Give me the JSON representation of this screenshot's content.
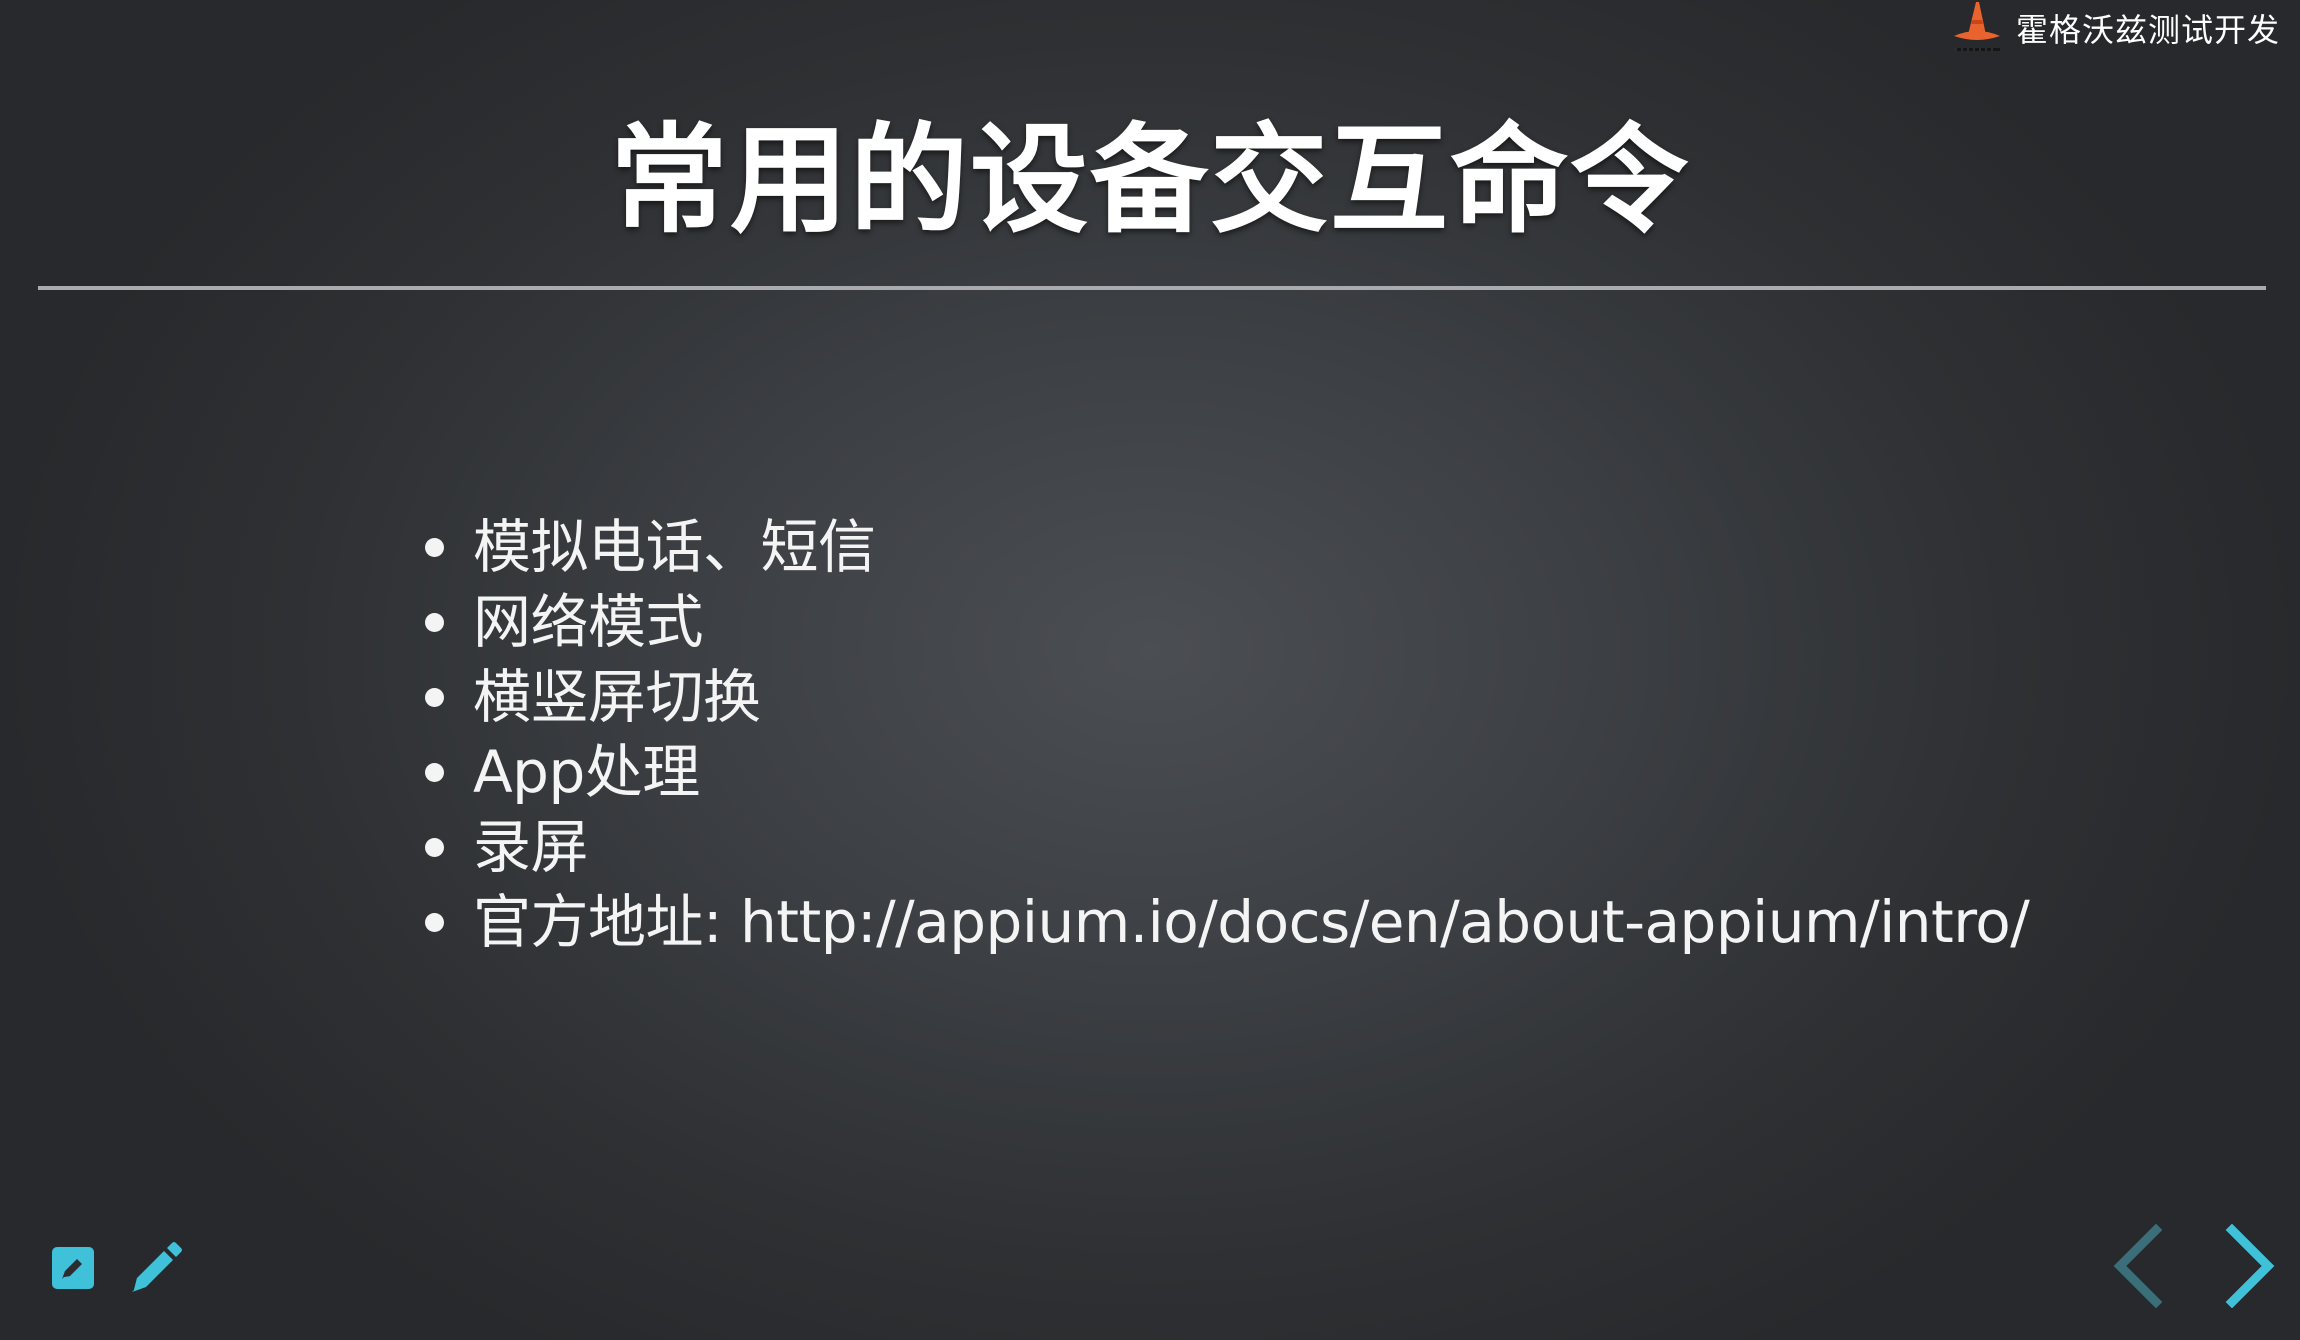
{
  "header": {
    "brand_name": "霍格沃兹测试开发",
    "logo_icon": "wizard-hat-icon"
  },
  "slide": {
    "title": "常用的设备交互命令",
    "bullets": [
      "模拟电话、短信",
      "网络模式",
      "横竖屏切换",
      "App处理",
      "录屏",
      "官方地址: http://appium.io/docs/en/about-appium/intro/"
    ]
  },
  "controls": {
    "left_tools": [
      "edit-note-icon",
      "pencil-icon"
    ],
    "nav": [
      "chevron-left-icon",
      "chevron-right-icon"
    ]
  },
  "colors": {
    "accent": "#3fc1d9",
    "accent_disabled": "#3a6f79",
    "text": "#f4f4f4",
    "logo_orange": "#e8642c"
  }
}
